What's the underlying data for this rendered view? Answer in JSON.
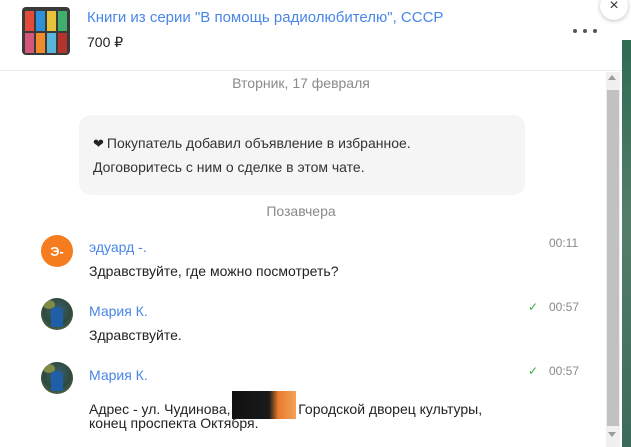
{
  "listing": {
    "title": "Книги из серии \"В помощь радиолюбителю\", СССР",
    "price": "700 ₽"
  },
  "header": {
    "more_icon": "more-horizontal-icon",
    "close_label": "×"
  },
  "chat": {
    "date_1": "Вторник, 17 февраля",
    "system_message": {
      "icon": "heart-icon",
      "heart": "❤",
      "line_1": "Покупатель добавил объявление в избранное.",
      "line_2": "Договоритесь с ним о сделке в этом чате."
    },
    "date_2": "Позавчера",
    "messages": [
      {
        "author": "эдуард -.",
        "avatar_letter": "Э-",
        "time": "00:11",
        "text": "Здравствуйте, где можно посмотреть?",
        "read": false
      },
      {
        "author": "Мария К.",
        "time": "00:57",
        "text": "Здравствуйте.",
        "read": true
      },
      {
        "author": "Мария К.",
        "time": "00:57",
        "text_part_1": "Адрес - ул. Чудинова,",
        "text_part_2": "Городской дворец культуры,",
        "text_line_2": "конец проспекта Октября.",
        "read": true
      }
    ],
    "check_mark": "✓"
  },
  "colors": {
    "accent": "#4a86e8",
    "avatar_orange": "#f57c1f",
    "read_check": "#2fb344",
    "system_bg": "#f5f5f5"
  }
}
